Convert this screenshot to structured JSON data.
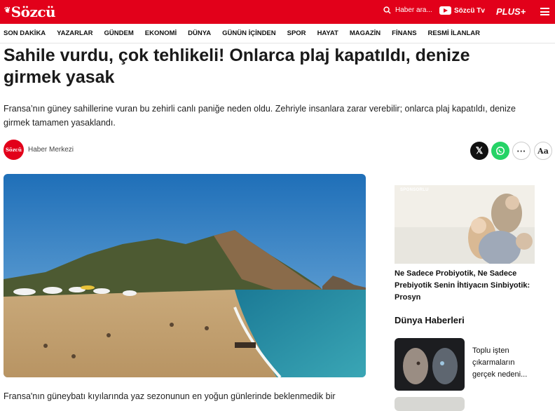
{
  "header": {
    "logo_text": "Sözcü",
    "search_label": "Haber ara...",
    "tv_label": "Sözcü Tv",
    "plus_label": "PLUS+"
  },
  "nav": {
    "items": [
      "SON DAKİKA",
      "YAZARLAR",
      "GÜNDEM",
      "EKONOMİ",
      "DÜNYA",
      "GÜNÜN İÇİNDEN",
      "SPOR",
      "HAYAT",
      "MAGAZİN",
      "FİNANS",
      "RESMİ İLANLAR"
    ]
  },
  "article": {
    "title": "Sahile vurdu, çok tehlikeli! Onlarca plaj kapatıldı, denize girmek yasak",
    "summary": "Fransa’nın güney sahillerine vuran bu zehirli canlı paniğe neden oldu. Zehriyle insanlara zarar verebilir; onlarca plaj kapatıldı, denize girmek tamamen yasaklandı.",
    "author_avatar_text": "Sözcü",
    "author": "Haber Merkezi",
    "body_first_line": "Fransa'nın güneybatı kıyılarında yaz sezonunun en yoğun günlerinde beklenmedik bir"
  },
  "share": {
    "x_glyph": "𝕏",
    "more_glyph": "···",
    "font_glyph": "Aa"
  },
  "sidebar": {
    "ad_label": "SPONSORLU",
    "ad_title": "Ne Sadece Probiyotik, Ne Sadece Prebiyotik Senin İhtiyacın Sinbiyotik: Prosyn",
    "section_title": "Dünya Haberleri",
    "news": [
      {
        "title": "Toplu işten çıkarmaların gerçek nedeni..."
      }
    ]
  },
  "colors": {
    "brand": "#e2001a",
    "whatsapp": "#25d366"
  }
}
